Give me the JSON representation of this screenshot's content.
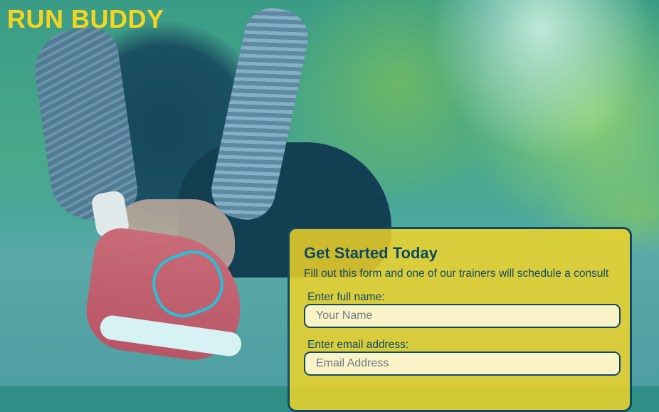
{
  "brand": {
    "name": "RUN BUDDY"
  },
  "hero": {
    "image_description_icon": "runner-tying-shoe-photo"
  },
  "form": {
    "title": "Get Started Today",
    "subtitle": "Fill out this form and one of our trainers will schedule a consult",
    "fields": [
      {
        "label": "Enter full name:",
        "placeholder": "Your Name",
        "value": ""
      },
      {
        "label": "Enter email address:",
        "placeholder": "Email Address",
        "value": ""
      }
    ]
  },
  "colors": {
    "brand_yellow": "#f7d51f",
    "navy": "#0f4a64",
    "form_bg": "#f7d624"
  }
}
